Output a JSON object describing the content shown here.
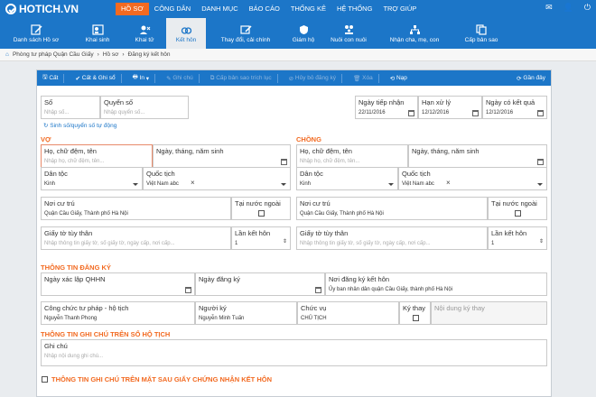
{
  "app": {
    "logo_text": "HOTICH.VN"
  },
  "top_menu": [
    {
      "label": "HỒ SƠ",
      "active": true
    },
    {
      "label": "CÔNG DÂN"
    },
    {
      "label": "DANH MỤC"
    },
    {
      "label": "BÁO CÁO"
    },
    {
      "label": "THỐNG KÊ"
    },
    {
      "label": "HỆ THỐNG"
    },
    {
      "label": "TRỢ GIÚP"
    }
  ],
  "toolbar": [
    {
      "label": "Danh sách Hồ sơ",
      "icon": "edit-list-icon"
    },
    {
      "label": "Khai sinh",
      "icon": "person-id-icon"
    },
    {
      "label": "Khai tử",
      "icon": "person-remove-icon"
    },
    {
      "label": "Kết hôn",
      "icon": "rings-icon",
      "active": true
    },
    {
      "label": "Thay đổi, cải chính",
      "icon": "pencil-card-icon"
    },
    {
      "label": "Giám hộ",
      "icon": "shield-icon"
    },
    {
      "label": "Nuôi con nuôi",
      "icon": "family-icon"
    },
    {
      "label": "Nhận cha, mẹ, con",
      "icon": "hierarchy-icon"
    },
    {
      "label": "Cấp bản sao",
      "icon": "copy-icon"
    }
  ],
  "breadcrumb": [
    "Phòng tư pháp Quận Cầu Giấy",
    "Hồ sơ",
    "Đăng ký kết hôn"
  ],
  "actions": {
    "save": "Cất",
    "save_new": "Cất & Ghi sổ",
    "print": "In",
    "note": "Ghi chú",
    "copy": "Cấp bản sao trích lục",
    "cancel_reg": "Hủy bỏ đăng ký",
    "delete": "Xóa",
    "load": "Nạp",
    "recent": "Gần đây"
  },
  "registry": {
    "so_label": "Số",
    "so_ph": "Nhập số...",
    "quyen_so_label": "Quyển số",
    "quyen_so_ph": "Nhập quyển số...",
    "ngay_tiep_nhan_label": "Ngày tiếp nhận",
    "ngay_tiep_nhan": "22/11/2016",
    "han_xu_ly_label": "Hạn xử lý",
    "han_xu_ly": "12/12/2016",
    "ngay_co_kq_label": "Ngày có kết quả",
    "ngay_co_kq": "12/12/2016",
    "auto_link": "Sinh số/quyển số tự động"
  },
  "wife": {
    "section": "VỢ",
    "name_label": "Họ, chữ đệm, tên",
    "name_ph": "Nhập họ, chữ đệm, tên...",
    "dob_label": "Ngày, tháng, năm sinh",
    "ethnic_label": "Dân tộc",
    "ethnic": "Kinh",
    "nation_label": "Quốc tịch",
    "nation": "Việt Nam abc",
    "residence_label": "Nơi cư trú",
    "residence": "Quận Cầu Giấy, Thành phố Hà Nội",
    "abroad_label": "Tại nước ngoài",
    "id_label": "Giấy tờ tùy thân",
    "id_ph": "Nhập thông tin giấy tờ, số giấy tờ, ngày cấp, nơi cấp...",
    "times_label": "Lần kết hôn",
    "times": "1"
  },
  "husband": {
    "section": "CHỒNG",
    "name_label": "Họ, chữ đệm, tên",
    "name_ph": "Nhập họ, chữ đệm, tên...",
    "dob_label": "Ngày, tháng, năm sinh",
    "ethnic_label": "Dân tộc",
    "ethnic": "Kinh",
    "nation_label": "Quốc tịch",
    "nation": "Việt Nam abc",
    "residence_label": "Nơi cư trú",
    "residence": "Quận Cầu Giấy, Thành phố Hà Nội",
    "abroad_label": "Tại nước ngoài",
    "id_label": "Giấy tờ tùy thân",
    "id_ph": "Nhập thông tin giấy tờ, số giấy tờ, ngày cấp, nơi cấp...",
    "times_label": "Lần kết hôn",
    "times": "1"
  },
  "registration": {
    "section": "THÔNG TIN ĐĂNG KÝ",
    "xac_lap_label": "Ngày xác lập QHHN",
    "ngay_dk_label": "Ngày đăng ký",
    "noi_dk_label": "Nơi đăng ký kết hôn",
    "noi_dk": "Ủy ban nhân dân quận Cầu Giấy, thành phố Hà Nội",
    "cong_chuc_label": "Công chức tư pháp - hộ tịch",
    "cong_chuc": "Nguyễn Thanh Phong",
    "nguoi_ky_label": "Người ký",
    "nguoi_ky": "Nguyễn Minh Tuấn",
    "chuc_vu_label": "Chức vụ",
    "chuc_vu": "CHỦ TỊCH",
    "ky_thay_label": "Ký thay",
    "noi_dung_ky_thay": "Nội dung ký thay"
  },
  "notes": {
    "section": "THÔNG TIN GHI CHÚ TRÊN SỔ HỘ TỊCH",
    "label": "Ghi chú",
    "ph": "Nhập nội dung ghi chú...",
    "back_section": "THÔNG TIN GHI CHÚ TRÊN MẶT SAU GIẤY CHỨNG NHẬN KẾT HÔN"
  }
}
